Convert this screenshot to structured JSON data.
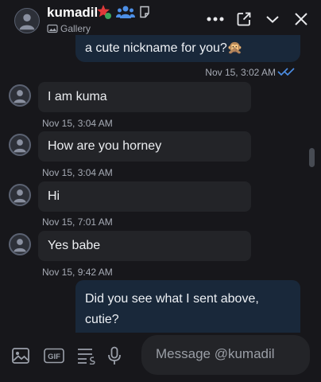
{
  "header": {
    "name": "kumadil",
    "subtitle": "Gallery"
  },
  "messages": {
    "out_top": {
      "text": "a cute nickname for you?🙊",
      "time": "Nov 15, 3:02 AM"
    },
    "incoming": [
      {
        "text": "I am kuma",
        "time": "Nov 15, 3:04 AM"
      },
      {
        "text": "How are you horney",
        "time": "Nov 15, 3:04 AM"
      },
      {
        "text": "Hi",
        "time": "Nov 15, 7:01 AM"
      },
      {
        "text": "Yes babe",
        "time": "Nov 15, 9:42 AM"
      }
    ],
    "out_bottom": {
      "text": "Did you see what I sent above, cutie?"
    }
  },
  "composer": {
    "placeholder": "Message @kumadil",
    "gif_label": "GIF"
  },
  "colors": {
    "background": "#17171b",
    "incoming_bubble": "#232428",
    "outgoing_bubble": "#19283a",
    "read_ticks": "#4d8fe6",
    "badge_star": "#e03a3a",
    "badge_group": "#4d8fe6"
  },
  "icons": [
    "avatar-person-icon",
    "star-badge-icon",
    "group-badge-icon",
    "note-icon",
    "gallery-icon",
    "more-icon",
    "popout-icon",
    "chevron-down-icon",
    "close-icon",
    "read-ticks-icon",
    "image-icon",
    "gif-icon",
    "list-icon",
    "microphone-icon"
  ]
}
